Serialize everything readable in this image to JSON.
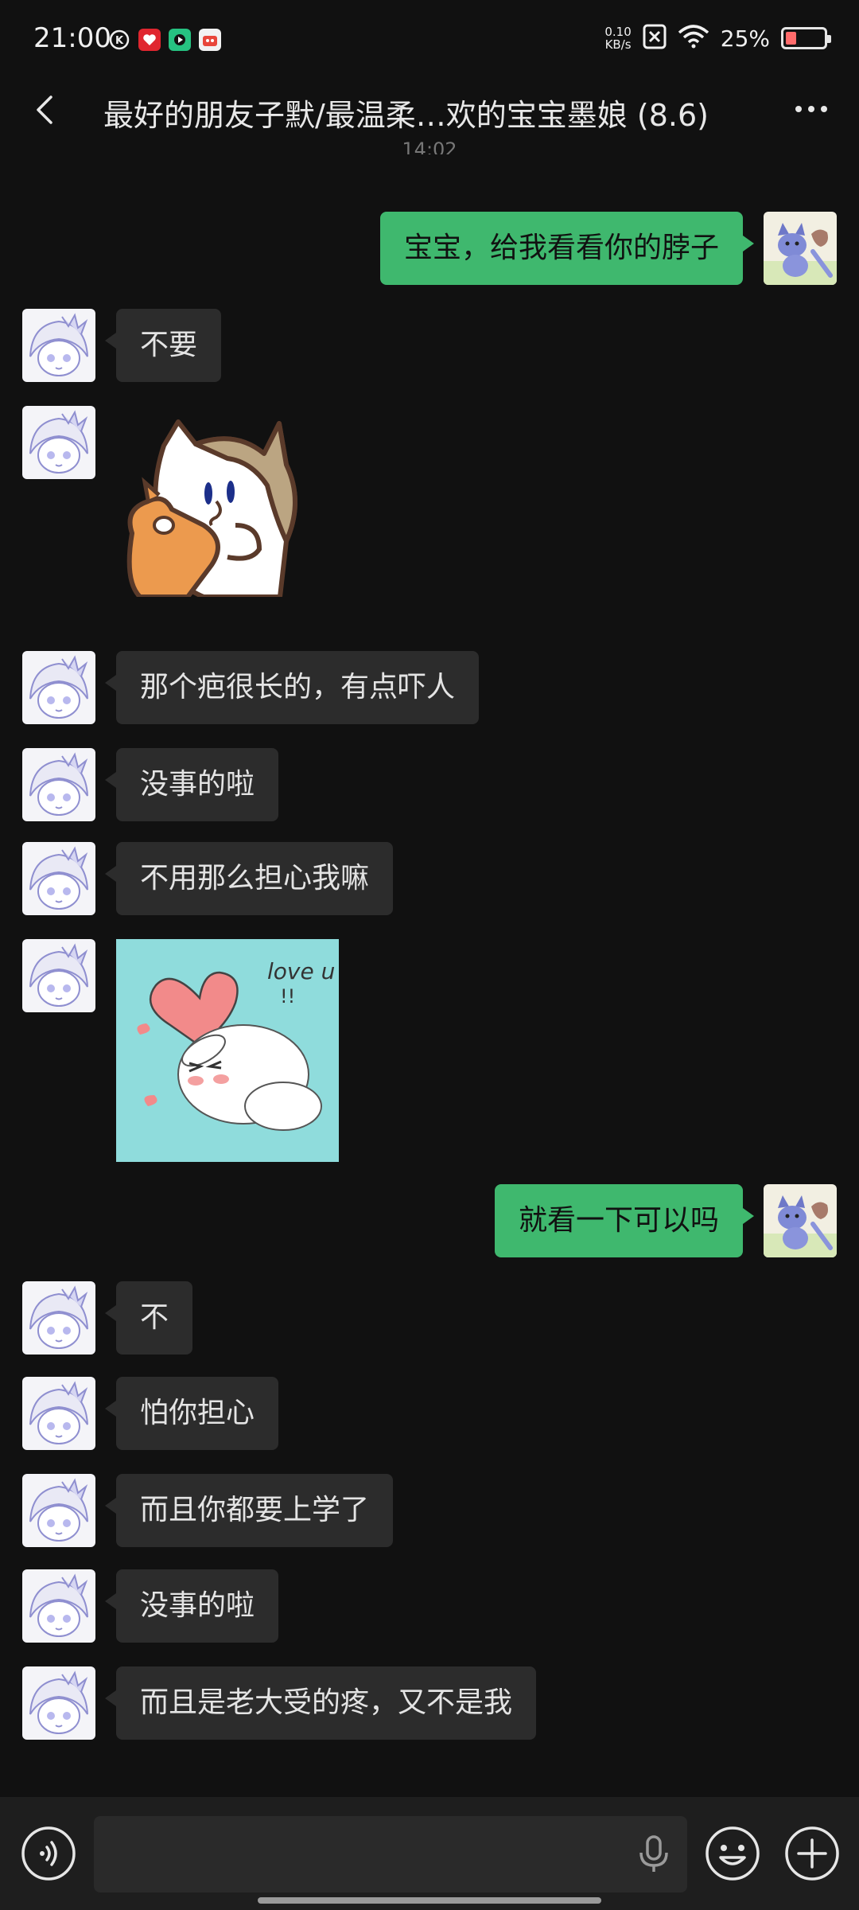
{
  "status_bar": {
    "time": "21:00",
    "net_speed_value": "0.10",
    "net_speed_unit": "KB/s",
    "battery_percent": "25%",
    "battery_level": 0.25,
    "icons": [
      "k-circle-icon",
      "red-app-icon",
      "green-app-icon",
      "red-orange-app-icon",
      "data-saver-icon",
      "wifi-icon",
      "battery-icon"
    ]
  },
  "header": {
    "title": "最好的朋友子默/最温柔…欢的宝宝墨娘 (8.6)",
    "back_icon": "chevron-left-icon",
    "more_icon": "more-dots-icon"
  },
  "timestamp": "14:02",
  "messages": [
    {
      "side": "right",
      "type": "text",
      "text": "宝宝，给我看看你的脖子"
    },
    {
      "side": "left",
      "type": "text",
      "text": "不要"
    },
    {
      "side": "left",
      "type": "sticker",
      "sticker": "cat-hugging-orange-cat-sticker"
    },
    {
      "side": "left",
      "type": "text",
      "text": "那个疤很长的，有点吓人"
    },
    {
      "side": "left",
      "type": "text",
      "text": "没事的啦"
    },
    {
      "side": "left",
      "type": "text",
      "text": "不用那么担心我嘛"
    },
    {
      "side": "left",
      "type": "sticker",
      "sticker": "love-u-dog-sticker",
      "sticker_text": "love u!!"
    },
    {
      "side": "right",
      "type": "text",
      "text": "就看一下可以吗"
    },
    {
      "side": "left",
      "type": "text",
      "text": "不"
    },
    {
      "side": "left",
      "type": "text",
      "text": "怕你担心"
    },
    {
      "side": "left",
      "type": "text",
      "text": "而且你都要上学了"
    },
    {
      "side": "left",
      "type": "text",
      "text": "没事的啦"
    },
    {
      "side": "left",
      "type": "text",
      "text": "而且是老大受的疼，又不是我"
    }
  ],
  "input_bar": {
    "voice_icon": "voice-wave-icon",
    "mic_icon": "microphone-icon",
    "emoji_icon": "emoji-icon",
    "plus_icon": "plus-circle-icon"
  },
  "colors": {
    "background": "#111111",
    "bubble_self": "#3fb86e",
    "bubble_other": "#2c2c2c"
  }
}
